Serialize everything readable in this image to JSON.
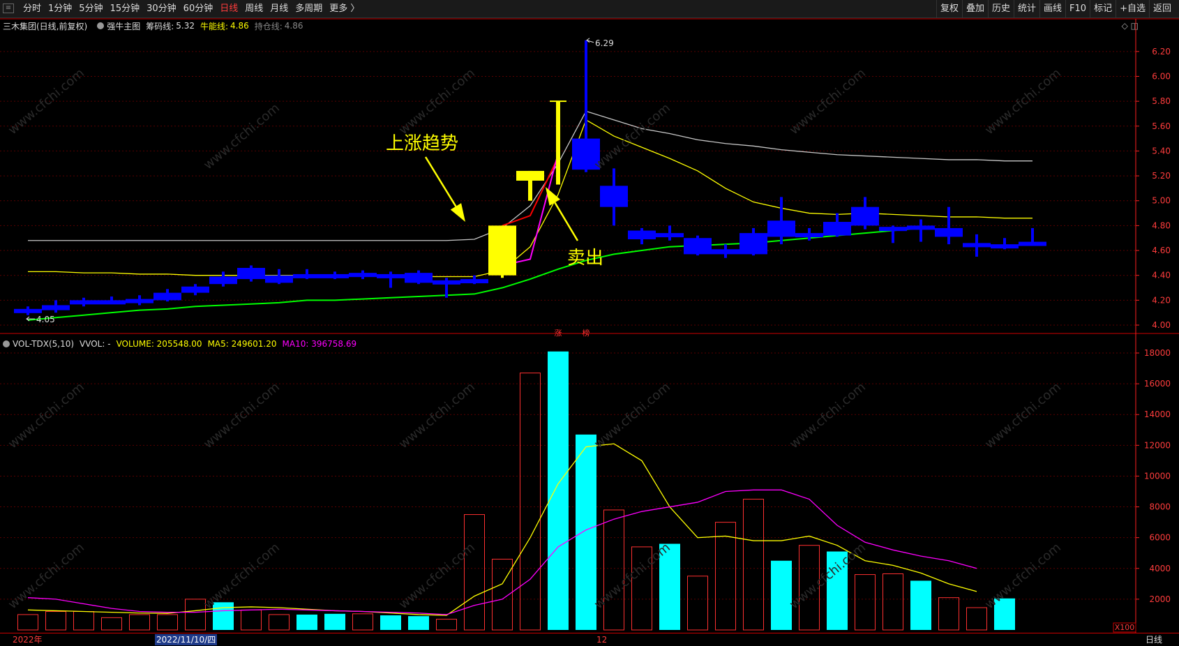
{
  "toolbar": {
    "periods": [
      "分时",
      "1分钟",
      "5分钟",
      "15分钟",
      "30分钟",
      "60分钟",
      "日线",
      "周线",
      "月线",
      "多周期",
      "更多 〉"
    ],
    "active_period": "日线",
    "right_tools": [
      "复权",
      "叠加",
      "历史",
      "统计",
      "画线",
      "F10",
      "标记",
      "+自选",
      "返回"
    ]
  },
  "main_legend": {
    "stock": "三木集团(日线,前复权)",
    "indicator": "强牛主图",
    "chip_label": "筹码线:",
    "chip_value": "5.32",
    "bull_label": "牛能线:",
    "bull_value": "4.86",
    "hold_label": "持仓线:",
    "hold_value": "4.86"
  },
  "vol_legend": {
    "name": "VOL-TDX(5,10)",
    "vvol": "VVOL: -",
    "volume": "VOLUME: 205548.00",
    "ma5": "MA5: 249601.20",
    "ma10": "MA10: 396758.69"
  },
  "annotations": {
    "trend": "上涨趋势",
    "sell": "卖出",
    "high": "6.29",
    "low": "4.05",
    "mark_zhang": "涨",
    "mark_bang": "榜"
  },
  "status": {
    "year": "2022年",
    "date": "2022/11/10/四",
    "month": "12",
    "period": "日线",
    "vol_unit": "X100"
  },
  "colors": {
    "down": "#0000ff",
    "up_hollow": "#ff3030",
    "yellow": "#ffff00",
    "cyan": "#00ffff",
    "green": "#00ff00",
    "magenta": "#ff00ff",
    "white": "#c8c8c8",
    "axis": "#ff2020"
  },
  "chart_data": [
    {
      "type": "candlestick",
      "ylim": [
        4.0,
        6.3
      ],
      "yticks": [
        4.0,
        4.2,
        4.4,
        4.6,
        4.8,
        5.0,
        5.2,
        5.4,
        5.6,
        5.8,
        6.0,
        6.2
      ],
      "candles": [
        {
          "o": 4.13,
          "c": 4.1,
          "h": 4.15,
          "l": 4.08,
          "color": "down"
        },
        {
          "o": 4.16,
          "c": 4.12,
          "h": 4.2,
          "l": 4.1,
          "color": "down"
        },
        {
          "o": 4.2,
          "c": 4.17,
          "h": 4.22,
          "l": 4.15,
          "color": "down"
        },
        {
          "o": 4.2,
          "c": 4.18,
          "h": 4.23,
          "l": 4.17,
          "color": "down"
        },
        {
          "o": 4.21,
          "c": 4.18,
          "h": 4.24,
          "l": 4.16,
          "color": "down"
        },
        {
          "o": 4.26,
          "c": 4.2,
          "h": 4.29,
          "l": 4.19,
          "color": "down"
        },
        {
          "o": 4.31,
          "c": 4.26,
          "h": 4.33,
          "l": 4.24,
          "color": "down"
        },
        {
          "o": 4.39,
          "c": 4.33,
          "h": 4.43,
          "l": 4.31,
          "color": "down"
        },
        {
          "o": 4.46,
          "c": 4.37,
          "h": 4.48,
          "l": 4.35,
          "color": "down"
        },
        {
          "o": 4.4,
          "c": 4.34,
          "h": 4.45,
          "l": 4.33,
          "color": "down"
        },
        {
          "o": 4.41,
          "c": 4.39,
          "h": 4.45,
          "l": 4.37,
          "color": "down"
        },
        {
          "o": 4.41,
          "c": 4.39,
          "h": 4.43,
          "l": 4.37,
          "color": "down"
        },
        {
          "o": 4.42,
          "c": 4.39,
          "h": 4.44,
          "l": 4.37,
          "color": "down"
        },
        {
          "o": 4.41,
          "c": 4.39,
          "h": 4.43,
          "l": 4.3,
          "color": "down"
        },
        {
          "o": 4.42,
          "c": 4.34,
          "h": 4.44,
          "l": 4.33,
          "color": "down"
        },
        {
          "o": 4.36,
          "c": 4.34,
          "h": 4.38,
          "l": 4.22,
          "color": "down"
        },
        {
          "o": 4.37,
          "c": 4.35,
          "h": 4.4,
          "l": 4.33,
          "color": "down"
        },
        {
          "o": 4.4,
          "c": 4.8,
          "h": 4.8,
          "l": 4.38,
          "color": "yellow"
        },
        {
          "o": 5.24,
          "c": 5.22,
          "h": 5.24,
          "l": 5.0,
          "color": "yellow",
          "tshape": true
        },
        {
          "o": 5.8,
          "c": 5.8,
          "h": 5.8,
          "l": 5.13,
          "color": "yellow",
          "line": true
        },
        {
          "o": 5.5,
          "c": 5.25,
          "h": 6.29,
          "l": 5.23,
          "color": "down"
        },
        {
          "o": 5.12,
          "c": 4.95,
          "h": 5.26,
          "l": 4.8,
          "color": "down"
        },
        {
          "o": 4.76,
          "c": 4.69,
          "h": 4.78,
          "l": 4.65,
          "color": "down"
        },
        {
          "o": 4.74,
          "c": 4.72,
          "h": 4.8,
          "l": 4.68,
          "color": "down"
        },
        {
          "o": 4.7,
          "c": 4.57,
          "h": 4.72,
          "l": 4.56,
          "color": "down"
        },
        {
          "o": 4.61,
          "c": 4.57,
          "h": 4.65,
          "l": 4.54,
          "color": "down"
        },
        {
          "o": 4.74,
          "c": 4.57,
          "h": 4.78,
          "l": 4.56,
          "color": "down"
        },
        {
          "o": 4.84,
          "c": 4.71,
          "h": 5.03,
          "l": 4.65,
          "color": "down"
        },
        {
          "o": 4.74,
          "c": 4.72,
          "h": 4.78,
          "l": 4.68,
          "color": "down"
        },
        {
          "o": 4.83,
          "c": 4.72,
          "h": 4.9,
          "l": 4.71,
          "color": "down"
        },
        {
          "o": 4.95,
          "c": 4.8,
          "h": 5.03,
          "l": 4.77,
          "color": "down"
        },
        {
          "o": 4.79,
          "c": 4.77,
          "h": 4.8,
          "l": 4.66,
          "color": "down"
        },
        {
          "o": 4.8,
          "c": 4.78,
          "h": 4.85,
          "l": 4.67,
          "color": "down"
        },
        {
          "o": 4.78,
          "c": 4.71,
          "h": 4.95,
          "l": 4.65,
          "color": "down"
        },
        {
          "o": 4.66,
          "c": 4.65,
          "h": 4.73,
          "l": 4.55,
          "color": "down"
        },
        {
          "o": 4.65,
          "c": 4.62,
          "h": 4.7,
          "l": 4.61,
          "color": "down"
        },
        {
          "o": 4.67,
          "c": 4.66,
          "h": 4.78,
          "l": 4.64,
          "color": "down"
        }
      ],
      "lines": {
        "white": [
          4.68,
          4.68,
          4.68,
          4.68,
          4.68,
          4.68,
          4.68,
          4.68,
          4.68,
          4.68,
          4.68,
          4.68,
          4.68,
          4.68,
          4.68,
          4.68,
          4.69,
          4.78,
          4.96,
          5.3,
          5.72,
          5.65,
          5.58,
          5.54,
          5.49,
          5.46,
          5.44,
          5.41,
          5.39,
          5.37,
          5.36,
          5.35,
          5.34,
          5.33,
          5.33,
          5.32,
          5.32
        ],
        "yellow": [
          4.43,
          4.43,
          4.42,
          4.42,
          4.41,
          4.41,
          4.4,
          4.4,
          4.4,
          4.4,
          4.4,
          4.4,
          4.4,
          4.4,
          4.39,
          4.39,
          4.39,
          4.44,
          4.63,
          5.05,
          5.65,
          5.52,
          5.43,
          5.34,
          5.24,
          5.1,
          4.99,
          4.94,
          4.9,
          4.89,
          4.9,
          4.89,
          4.88,
          4.87,
          4.87,
          4.86,
          4.86
        ],
        "green": [
          4.04,
          4.06,
          4.08,
          4.1,
          4.12,
          4.13,
          4.15,
          4.16,
          4.17,
          4.18,
          4.2,
          4.2,
          4.21,
          4.22,
          4.23,
          4.24,
          4.25,
          4.3,
          4.37,
          4.45,
          4.52,
          4.57,
          4.6,
          4.63,
          4.64,
          4.65,
          4.66,
          4.68,
          4.7,
          4.72,
          4.74,
          4.76,
          4.78,
          null,
          null,
          null,
          null
        ],
        "red": [
          null,
          null,
          null,
          null,
          null,
          null,
          null,
          null,
          null,
          null,
          null,
          null,
          null,
          null,
          null,
          null,
          null,
          4.8,
          4.88,
          5.35,
          null,
          null,
          null,
          null,
          null,
          null,
          null,
          null,
          null,
          null,
          null,
          null,
          null,
          null,
          null,
          null,
          null
        ],
        "magenta": [
          null,
          null,
          null,
          null,
          null,
          null,
          null,
          null,
          null,
          null,
          null,
          null,
          null,
          null,
          null,
          null,
          null,
          4.48,
          4.53,
          5.38,
          null,
          null,
          null,
          null,
          null,
          null,
          null,
          null,
          null,
          null,
          null,
          null,
          null,
          null,
          null,
          null,
          null
        ]
      }
    },
    {
      "type": "bar",
      "ylim": [
        0,
        18000
      ],
      "yticks": [
        2000,
        4000,
        6000,
        8000,
        10000,
        12000,
        14000,
        16000,
        18000
      ],
      "values": [
        1000,
        1200,
        1200,
        800,
        1000,
        1000,
        2000,
        1800,
        1300,
        1000,
        1000,
        1050,
        1050,
        950,
        900,
        700,
        7500,
        4600,
        16700,
        18100,
        12700,
        7800,
        5400,
        5600,
        3500,
        7000,
        8500,
        4500,
        5500,
        5100,
        3600,
        3650,
        3200,
        2100,
        1450,
        2050,
        null
      ],
      "styles": [
        "hollow",
        "hollow",
        "hollow",
        "hollow",
        "hollow",
        "hollow",
        "hollow",
        "solid",
        "hollow",
        "hollow",
        "solid",
        "solid",
        "hollow",
        "solid",
        "solid",
        "hollow",
        "hollow",
        "hollow",
        "hollow",
        "solid",
        "solid",
        "hollow",
        "hollow",
        "solid",
        "hollow",
        "hollow",
        "hollow",
        "solid",
        "hollow",
        "solid",
        "hollow",
        "hollow",
        "solid",
        "hollow",
        "hollow",
        "solid",
        null
      ],
      "ma5": [
        1300,
        1250,
        1200,
        1150,
        1100,
        1080,
        1250,
        1450,
        1500,
        1450,
        1350,
        1250,
        1200,
        1100,
        1000,
        950,
        2200,
        3000,
        6000,
        9500,
        11900,
        12100,
        11000,
        8000,
        6000,
        6100,
        5800,
        5800,
        6100,
        5500,
        4500,
        4200,
        3700,
        3000,
        2500
      ],
      "ma10": [
        2100,
        2000,
        1700,
        1400,
        1200,
        1150,
        1150,
        1250,
        1300,
        1350,
        1300,
        1250,
        1200,
        1150,
        1100,
        1000,
        1600,
        2000,
        3300,
        5400,
        6500,
        7200,
        7700,
        8000,
        8300,
        9000,
        9100,
        9100,
        8500,
        6800,
        5700,
        5200,
        4800,
        4500,
        4000
      ]
    }
  ]
}
